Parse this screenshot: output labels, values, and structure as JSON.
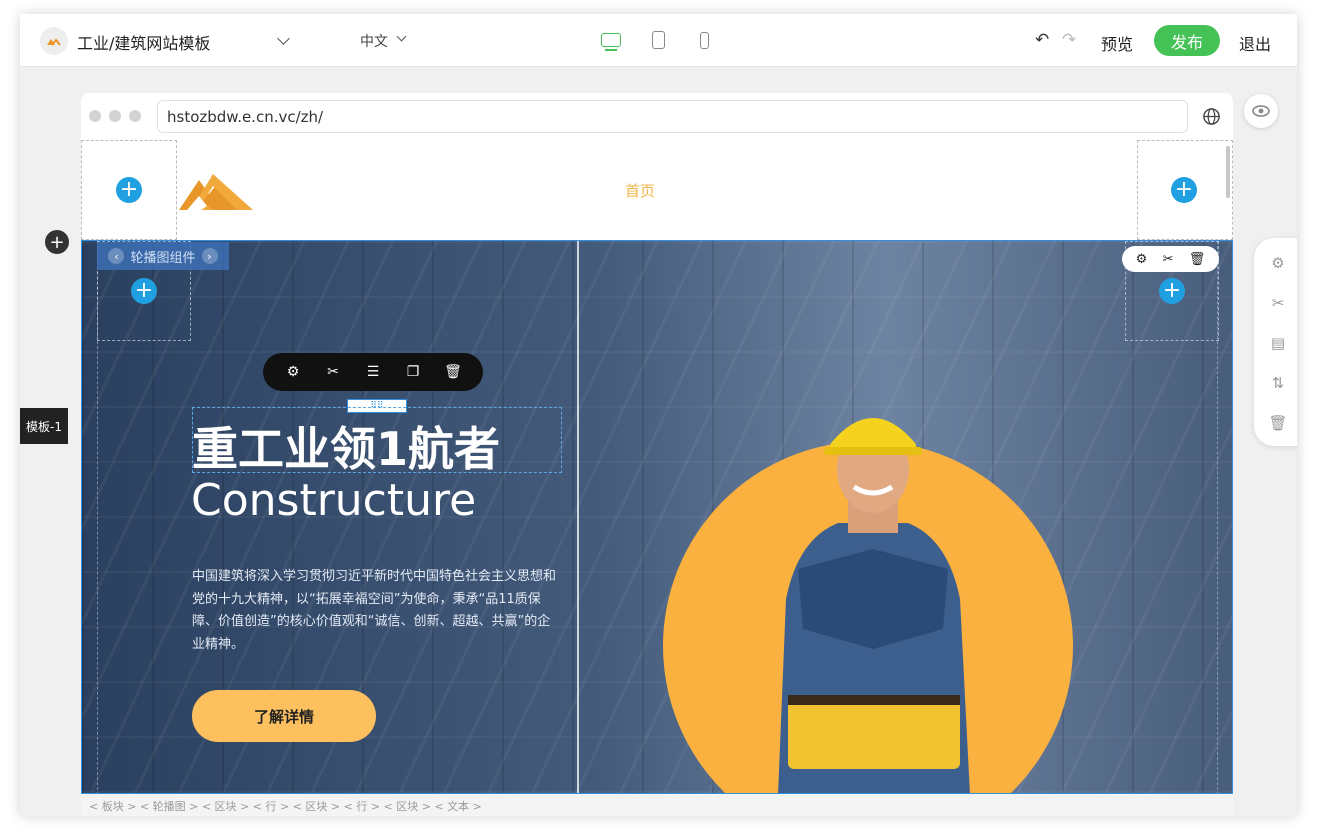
{
  "topbar": {
    "site_name": "工业/建筑网站模板",
    "language": "中文",
    "preview_label": "预览",
    "publish_label": "发布",
    "exit_label": "退出",
    "undo_icon": "undo-icon",
    "redo_icon": "redo-icon",
    "devices": [
      "desktop-icon",
      "tablet-icon",
      "mobile-icon"
    ],
    "active_device": "desktop"
  },
  "browser": {
    "url": "hstozbdw.e.cn.vc/zh/"
  },
  "site_header": {
    "nav_home": "首页"
  },
  "hero": {
    "carousel_label": "轮播图组件",
    "title": "重工业领1航者",
    "subtitle": "Constructure",
    "description": "中国建筑将深入学习贯彻习近平新时代中国特色社会主义思想和党的十九大精神，以“拓展幸福空间”为使命，秉承“品11质保障、价值创造”的核心价值观和“诚信、创新、超越、共赢”的企业精神。",
    "button_label": "了解详情",
    "drag_handle": "⠿⠿"
  },
  "editor": {
    "template_label": "模板-1",
    "breadcrumb": "< 板块 >  < 轮播图 >  < 区块 >  < 行 >  < 区块 >  < 行 >  < 区块 >  < 文本 >"
  },
  "colors": {
    "publish": "#45c255",
    "accent": "#fbb140",
    "button": "#fcc15e",
    "nav_active": "#f5b547",
    "plus": "#20a0e0",
    "selection": "#2f8fe0"
  }
}
